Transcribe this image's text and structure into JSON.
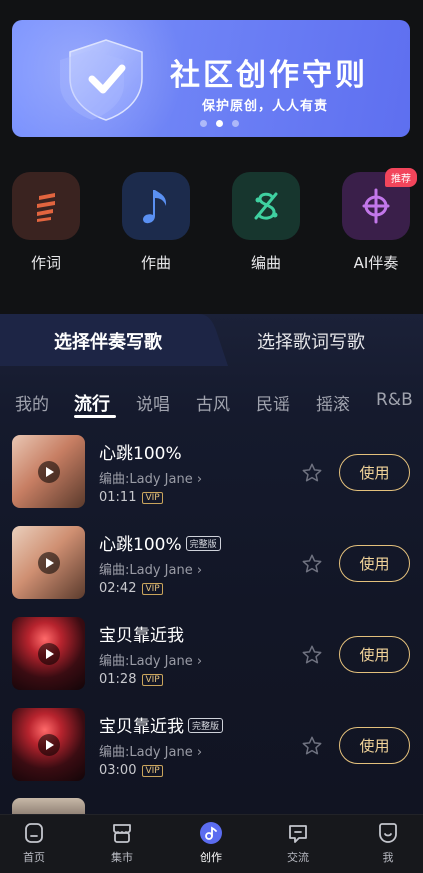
{
  "banner": {
    "title": "社区创作守则",
    "subtitle": "保护原创，人人有责",
    "dots": 3,
    "active_dot": 1
  },
  "tools": [
    {
      "label": "作词",
      "icon": "lyrics-icon",
      "color": "#e0603f"
    },
    {
      "label": "作曲",
      "icon": "music-note-icon",
      "color": "#5b8ff0"
    },
    {
      "label": "编曲",
      "icon": "arrange-icon",
      "color": "#3fcf9a"
    },
    {
      "label": "AI伴奏",
      "icon": "ai-accompany-icon",
      "color": "#b46be8",
      "badge": "推荐"
    }
  ],
  "segments": {
    "left": "选择伴奏写歌",
    "right": "选择歌词写歌"
  },
  "genres": [
    "我的",
    "流行",
    "说唱",
    "古风",
    "民谣",
    "摇滚",
    "R&B"
  ],
  "active_genre": "流行",
  "songs": [
    {
      "title": "心跳100%",
      "full": "",
      "arranger": "编曲:Lady Jane",
      "time": "01:11",
      "vip": "VIP",
      "button": "使用"
    },
    {
      "title": "心跳100%",
      "full": "完整版",
      "arranger": "编曲:Lady Jane",
      "time": "02:42",
      "vip": "VIP",
      "button": "使用"
    },
    {
      "title": "宝贝靠近我",
      "full": "",
      "arranger": "编曲:Lady Jane",
      "time": "01:28",
      "vip": "VIP",
      "button": "使用"
    },
    {
      "title": "宝贝靠近我",
      "full": "完整版",
      "arranger": "编曲:Lady Jane",
      "time": "03:00",
      "vip": "VIP",
      "button": "使用"
    }
  ],
  "nav": [
    {
      "label": "首页",
      "icon": "home-icon"
    },
    {
      "label": "集市",
      "icon": "market-icon"
    },
    {
      "label": "创作",
      "icon": "create-icon",
      "active": true
    },
    {
      "label": "交流",
      "icon": "chat-icon"
    },
    {
      "label": "我",
      "icon": "profile-icon"
    }
  ],
  "colors": {
    "accent_gold": "#e3c07c",
    "banner": "#6f84f6",
    "nav_active": "#5b6cf0"
  }
}
